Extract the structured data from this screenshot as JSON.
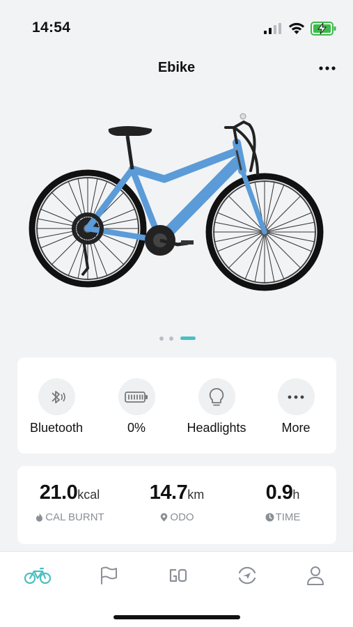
{
  "status_bar": {
    "time": "14:54"
  },
  "header": {
    "title": "Ebike"
  },
  "hero": {
    "pager_count": 3,
    "pager_active_index": 2
  },
  "controls": [
    {
      "label": "Bluetooth",
      "icon": "bluetooth-icon"
    },
    {
      "label": "0%",
      "icon": "battery-icon"
    },
    {
      "label": "Headlights",
      "icon": "bulb-icon"
    },
    {
      "label": "More",
      "icon": "more-icon"
    }
  ],
  "stats": [
    {
      "value": "21.0",
      "unit": "kcal",
      "caption": "CAL BURNT",
      "icon": "flame-icon"
    },
    {
      "value": "14.7",
      "unit": "km",
      "caption": "ODO",
      "icon": "location-pin-icon"
    },
    {
      "value": "0.9",
      "unit": "h",
      "caption": "TIME",
      "icon": "clock-icon"
    }
  ],
  "tabs": [
    {
      "name": "bike",
      "icon": "bike-icon",
      "active": true
    },
    {
      "name": "flag",
      "icon": "flag-icon",
      "active": false
    },
    {
      "name": "go",
      "icon": "go-icon",
      "active": false
    },
    {
      "name": "navigate",
      "icon": "compass-icon",
      "active": false
    },
    {
      "name": "profile",
      "icon": "person-icon",
      "active": false
    }
  ],
  "colors": {
    "accent": "#4cbfc1",
    "bike_frame": "#5b9bd8",
    "background": "#f1f3f5"
  }
}
